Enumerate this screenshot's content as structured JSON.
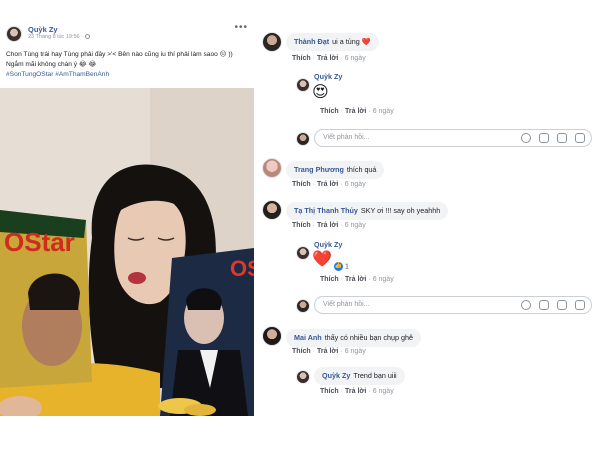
{
  "post": {
    "author": "Quỳk Zy",
    "time": "23 Tháng 8 lúc 19:56 ·",
    "more": "•••",
    "line1": "Chon Tùng trái hay Tùng phải đây >'< Bên nào cũng iu thí phải làm saoo 😔 ))",
    "line2": "Ngắm mãi không chán ý 😂 😂",
    "hashtags": "#SonTungOStar #AmThamBenAnh"
  },
  "comments": [
    {
      "id": "c1",
      "name": "Thành Đạt",
      "text": "ui a tủng ❤️",
      "like": "Thích",
      "reply": "Trả lời",
      "time": "6 ngày"
    },
    {
      "id": "r1",
      "name": "Quỳk Zy",
      "emoji": "😍",
      "like": "Thích",
      "reply": "Trả lời",
      "time": "6 ngày"
    },
    {
      "id": "c2",
      "name": "Trang Phương",
      "text": "thích quá",
      "like": "Thích",
      "reply": "Trả lời",
      "time": "6 ngày"
    },
    {
      "id": "c3",
      "name": "Tạ Thị Thanh Thủy",
      "text": "SKY ơi !!! say oh yeahhh",
      "like": "Thích",
      "reply": "Trả lời",
      "time": "6 ngày"
    },
    {
      "id": "r2",
      "name": "Quỳk Zy",
      "emoji": "❤️",
      "likes": "1",
      "like": "Thích",
      "reply": "Trả lời",
      "time": "6 ngày"
    },
    {
      "id": "c4",
      "name": "Mai Anh",
      "text": "thấy có nhiều bạn chụp ghê",
      "like": "Thích",
      "reply": "Trả lời",
      "time": "6 ngày"
    },
    {
      "id": "r3",
      "name": "Quỳk Zy",
      "text": "Trend bạn uiii",
      "like": "Thích",
      "reply": "Trả lời",
      "time": "6 ngày"
    }
  ],
  "reply_placeholder": "Viết phản hồi...",
  "photo": {
    "chip_bag_left_text": "OStar",
    "chip_bag_right_text": "OS"
  },
  "icons": [
    "globe-icon",
    "emoji-icon",
    "camera-icon",
    "gif-icon",
    "sticker-icon",
    "like-icon"
  ],
  "colors": {
    "link": "#385898",
    "bubble": "#f2f3f5",
    "muted": "#90949c",
    "like_blue": "#1877f2"
  }
}
